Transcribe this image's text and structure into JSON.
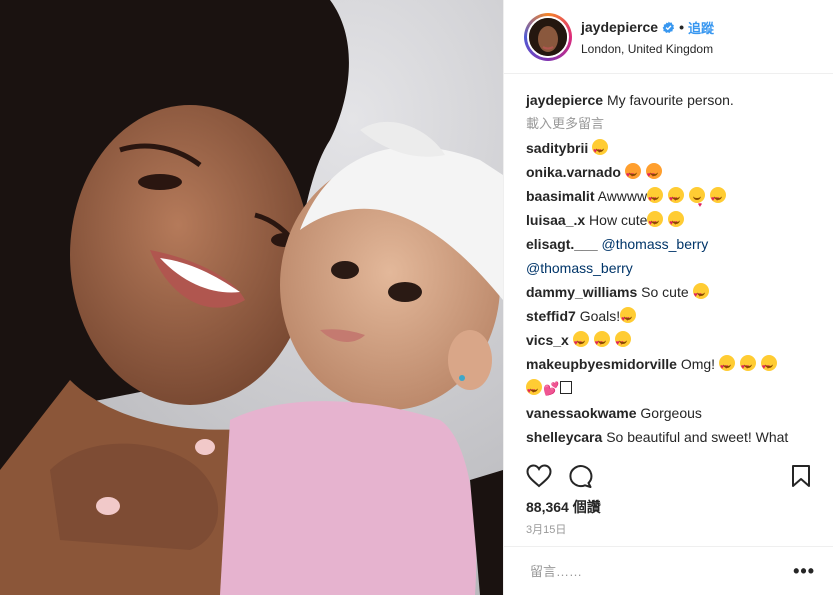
{
  "header": {
    "username": "jaydepierce",
    "separator": "•",
    "follow_label": "追蹤",
    "location": "London, United Kingdom"
  },
  "caption": {
    "username": "jaydepierce",
    "text": "My favourite person."
  },
  "load_more_label": "載入更多留言",
  "comments": [
    {
      "username": "saditybrii",
      "text": ""
    },
    {
      "username": "onika.varnado",
      "text": ""
    },
    {
      "username": "baasimalit",
      "text": "Awwww"
    },
    {
      "username": "luisaa_.x",
      "text": "How cute"
    },
    {
      "username": "elisagt.___",
      "mention1": "@thomass_berry",
      "mention2": "@thomass_berry"
    },
    {
      "username": "dammy_williams",
      "text": "So cute"
    },
    {
      "username": "steffid7",
      "text": "Goals!"
    },
    {
      "username": "vics_x",
      "text": ""
    },
    {
      "username": "makeupbyesmidorville",
      "text": "Omg!"
    },
    {
      "username": "vanessaokwame",
      "text": "Gorgeous"
    },
    {
      "username": "shelleycara",
      "text": "So beautiful and sweet! What type of conditioners and gel? Lotion? Do"
    }
  ],
  "likes_label": "88,364 個讚",
  "date_label": "3月15日",
  "comment_input": {
    "placeholder": "留言……"
  },
  "icons": {
    "like": "heart-outline-icon",
    "comment": "speech-bubble-icon",
    "save": "bookmark-icon",
    "options": "more-horizontal-icon",
    "verified": "verified-badge-icon"
  },
  "colors": {
    "link": "#3897f0",
    "mention": "#003569",
    "muted": "#999999",
    "text": "#262626"
  }
}
